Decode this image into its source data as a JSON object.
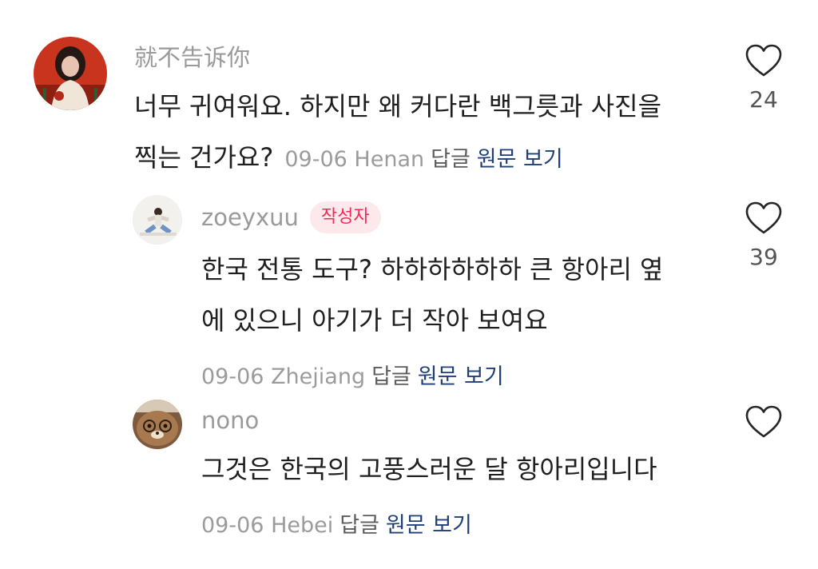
{
  "comments": [
    {
      "username": "就不告诉你",
      "text": "너무 귀여워요. 하지만 왜 커다란 백그릇과 사진을",
      "text2": "찍는 건가요?",
      "date": "09-06",
      "location": "Henan",
      "reply_label": "답글",
      "original_label": "원문 보기",
      "likes": "24"
    },
    {
      "username": "zoeyxuu",
      "badge": "작성자",
      "text": "한국 전통 도구? 하하하하하하 큰 항아리 옆",
      "text2": "에 있으니 아기가 더 작아 보여요",
      "date": "09-06",
      "location": "Zhejiang",
      "reply_label": "답글",
      "original_label": "원문 보기",
      "likes": "39"
    },
    {
      "username": "nono",
      "text": "그것은 한국의 고풍스러운 달 항아리입니다",
      "date": "09-06",
      "location": "Hebei",
      "reply_label": "답글",
      "original_label": "원문 보기"
    }
  ],
  "colors": {
    "accent_badge": "#ee2a55",
    "badge_bg": "#fde9ec",
    "link": "#1f3f78",
    "meta": "#9b9b9b"
  }
}
